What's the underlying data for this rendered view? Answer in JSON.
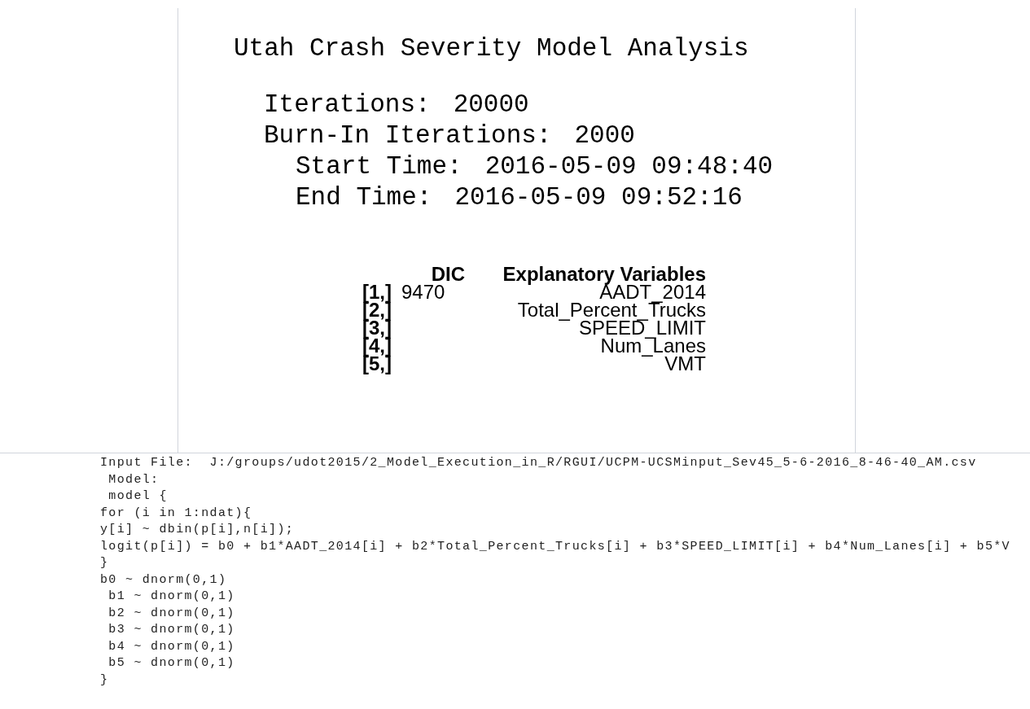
{
  "plot_panel": {
    "title": "Utah Crash Severity Model Analysis",
    "settings": [
      {
        "label": "Iterations:",
        "value": "20000"
      },
      {
        "label": "Burn-In Iterations:",
        "value": "2000"
      },
      {
        "label": "Start Time:",
        "value": "2016-05-09 09:48:40"
      },
      {
        "label": "End Time:",
        "value": "2016-05-09 09:52:16"
      }
    ],
    "table": {
      "columns": [
        "DIC",
        "Explanatory Variables"
      ],
      "rows": [
        {
          "label": "[1,]",
          "dic": "9470",
          "variable": "AADT_2014"
        },
        {
          "label": "[2,]",
          "variable": "Total_Percent_Trucks"
        },
        {
          "label": "[3,]",
          "variable": "SPEED_LIMIT"
        },
        {
          "label": "[4,]",
          "variable": "Num_Lanes"
        },
        {
          "label": "[5,]",
          "variable": "VMT"
        }
      ]
    }
  },
  "console": {
    "lines": [
      "Input File:  J:/groups/udot2015/2_Model_Execution_in_R/RGUI/UCPM-UCSMinput_Sev45_5-6-2016_8-46-40_AM.csv",
      " Model:",
      " model {",
      "for (i in 1:ndat){",
      "y[i] ~ dbin(p[i],n[i]);",
      "logit(p[i]) = b0 + b1*AADT_2014[i] + b2*Total_Percent_Trucks[i] + b3*SPEED_LIMIT[i] + b4*Num_Lanes[i] + b5*V",
      "}",
      "b0 ~ dnorm(0,1)",
      " b1 ~ dnorm(0,1)",
      " b2 ~ dnorm(0,1)",
      " b3 ~ dnorm(0,1)",
      " b4 ~ dnorm(0,1)",
      " b5 ~ dnorm(0,1)",
      "}"
    ]
  }
}
